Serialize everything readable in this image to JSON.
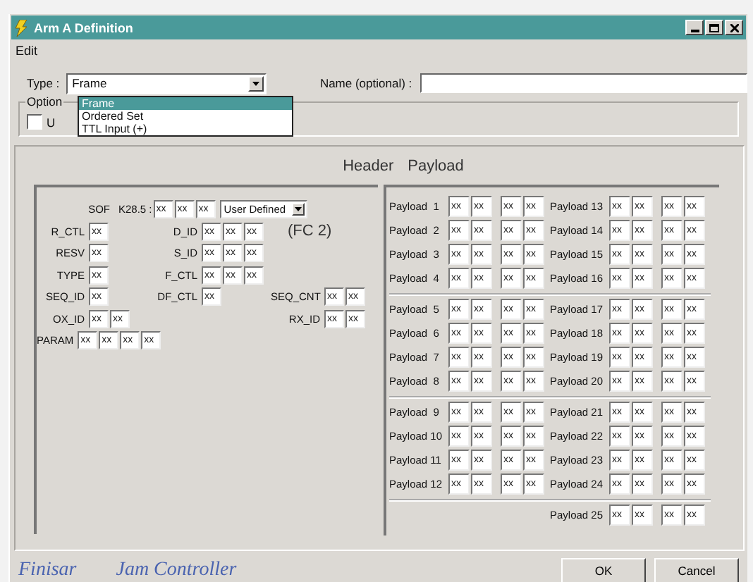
{
  "window": {
    "title": "Arm A Definition"
  },
  "menu": [
    "Edit"
  ],
  "type_field": {
    "label": "Type :",
    "value": "Frame",
    "options": [
      {
        "label": "Frame",
        "selected": true
      },
      {
        "label": "Ordered Set",
        "selected": false
      },
      {
        "label": "TTL Input (+)",
        "selected": false
      }
    ]
  },
  "name_field": {
    "label": "Name (optional) :"
  },
  "options_group": {
    "title": "Option",
    "checkbox": {
      "label": "U",
      "checked": false
    }
  },
  "header": {
    "title": "Header",
    "sof": {
      "label": "SOF",
      "sub_label": "K28.5 :",
      "values": [
        "xx",
        "xx",
        "xx"
      ],
      "mode": "User Defined"
    },
    "rows": [
      {
        "left": {
          "label": "R_CTL",
          "values": [
            "xx"
          ]
        },
        "middle": {
          "label": "D_ID",
          "values": [
            "xx",
            "xx",
            "xx"
          ]
        },
        "right": {
          "note": "(FC 2)"
        }
      },
      {
        "left": {
          "label": "RESV",
          "values": [
            "xx"
          ]
        },
        "middle": {
          "label": "S_ID",
          "values": [
            "xx",
            "xx",
            "xx"
          ]
        }
      },
      {
        "left": {
          "label": "TYPE",
          "values": [
            "xx"
          ]
        },
        "middle": {
          "label": "F_CTL",
          "values": [
            "xx",
            "xx",
            "xx"
          ]
        }
      },
      {
        "left": {
          "label": "SEQ_ID",
          "values": [
            "xx"
          ]
        },
        "middle": {
          "label": "DF_CTL",
          "values": [
            "xx"
          ]
        },
        "right": {
          "label": "SEQ_CNT",
          "values": [
            "xx",
            "xx"
          ]
        }
      },
      {
        "left": {
          "label": "OX_ID",
          "values": [
            "xx",
            "xx"
          ]
        },
        "right": {
          "label": "RX_ID",
          "values": [
            "xx",
            "xx"
          ]
        }
      },
      {
        "left": {
          "label": "PARAM",
          "values": [
            "xx",
            "xx",
            "xx",
            "xx"
          ]
        }
      }
    ]
  },
  "payload": {
    "title": "Payload",
    "sections": [
      {
        "rows": [
          {
            "left": {
              "label": "Payload  1",
              "values": [
                "xx",
                "xx",
                "xx",
                "xx"
              ]
            },
            "right": {
              "label": "Payload 13",
              "values": [
                "xx",
                "xx",
                "xx",
                "xx"
              ]
            }
          },
          {
            "left": {
              "label": "Payload  2",
              "values": [
                "xx",
                "xx",
                "xx",
                "xx"
              ]
            },
            "right": {
              "label": "Payload 14",
              "values": [
                "xx",
                "xx",
                "xx",
                "xx"
              ]
            }
          },
          {
            "left": {
              "label": "Payload  3",
              "values": [
                "xx",
                "xx",
                "xx",
                "xx"
              ]
            },
            "right": {
              "label": "Payload 15",
              "values": [
                "xx",
                "xx",
                "xx",
                "xx"
              ]
            }
          },
          {
            "left": {
              "label": "Payload  4",
              "values": [
                "xx",
                "xx",
                "xx",
                "xx"
              ]
            },
            "right": {
              "label": "Payload 16",
              "values": [
                "xx",
                "xx",
                "xx",
                "xx"
              ]
            }
          }
        ]
      },
      {
        "rows": [
          {
            "left": {
              "label": "Payload  5",
              "values": [
                "xx",
                "xx",
                "xx",
                "xx"
              ]
            },
            "right": {
              "label": "Payload 17",
              "values": [
                "xx",
                "xx",
                "xx",
                "xx"
              ]
            }
          },
          {
            "left": {
              "label": "Payload  6",
              "values": [
                "xx",
                "xx",
                "xx",
                "xx"
              ]
            },
            "right": {
              "label": "Payload 18",
              "values": [
                "xx",
                "xx",
                "xx",
                "xx"
              ]
            }
          },
          {
            "left": {
              "label": "Payload  7",
              "values": [
                "xx",
                "xx",
                "xx",
                "xx"
              ]
            },
            "right": {
              "label": "Payload 19",
              "values": [
                "xx",
                "xx",
                "xx",
                "xx"
              ]
            }
          },
          {
            "left": {
              "label": "Payload  8",
              "values": [
                "xx",
                "xx",
                "xx",
                "xx"
              ]
            },
            "right": {
              "label": "Payload 20",
              "values": [
                "xx",
                "xx",
                "xx",
                "xx"
              ]
            }
          }
        ]
      },
      {
        "rows": [
          {
            "left": {
              "label": "Payload  9",
              "values": [
                "xx",
                "xx",
                "xx",
                "xx"
              ]
            },
            "right": {
              "label": "Payload 21",
              "values": [
                "xx",
                "xx",
                "xx",
                "xx"
              ]
            }
          },
          {
            "left": {
              "label": "Payload 10",
              "values": [
                "xx",
                "xx",
                "xx",
                "xx"
              ]
            },
            "right": {
              "label": "Payload 22",
              "values": [
                "xx",
                "xx",
                "xx",
                "xx"
              ]
            }
          },
          {
            "left": {
              "label": "Payload 11",
              "values": [
                "xx",
                "xx",
                "xx",
                "xx"
              ]
            },
            "right": {
              "label": "Payload 23",
              "values": [
                "xx",
                "xx",
                "xx",
                "xx"
              ]
            }
          },
          {
            "left": {
              "label": "Payload 12",
              "values": [
                "xx",
                "xx",
                "xx",
                "xx"
              ]
            },
            "right": {
              "label": "Payload 24",
              "values": [
                "xx",
                "xx",
                "xx",
                "xx"
              ]
            }
          }
        ]
      },
      {
        "rows": [
          {
            "right": {
              "label": "Payload 25",
              "values": [
                "xx",
                "xx",
                "xx",
                "xx"
              ]
            }
          }
        ]
      }
    ]
  },
  "footer": {
    "brand": "Finisar",
    "product": "Jam Controller",
    "buttons": [
      "OK",
      "Cancel"
    ]
  }
}
